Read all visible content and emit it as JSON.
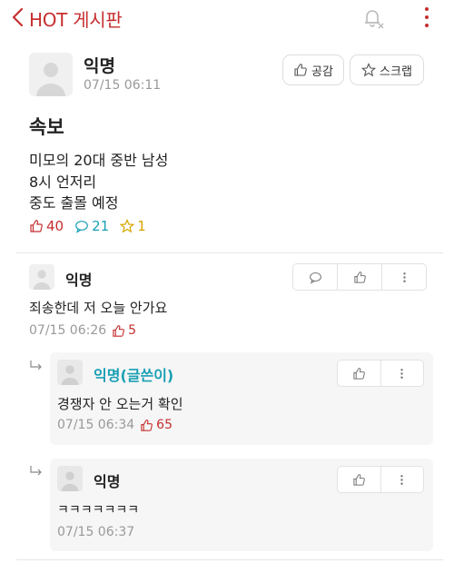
{
  "header": {
    "title": "HOT 게시판",
    "back_icon": "chevron-left-icon",
    "bell_icon": "bell-off-icon",
    "more_icon": "more-vertical-icon"
  },
  "post": {
    "author": "익명",
    "time": "07/15 06:11",
    "like_button": "공감",
    "scrap_button": "스크랩",
    "title": "속보",
    "body": [
      "미모의 20대 중반 남성",
      "8시 언저리",
      "중도 출몰 예정"
    ],
    "stats": {
      "likes": "40",
      "comments": "21",
      "scraps": "1"
    }
  },
  "comments": [
    {
      "author": "익명",
      "text": "죄송한데 저 오늘 안가요",
      "time": "07/15 06:26",
      "likes": "5"
    }
  ],
  "replies": [
    {
      "author": "익명(글쓴이)",
      "text": "경쟁자 안 오는거 확인",
      "time": "07/15 06:34",
      "likes": "65"
    },
    {
      "author": "익명",
      "text": "ㅋㅋㅋㅋㅋㅋㅋ",
      "time": "07/15 06:37"
    }
  ],
  "colors": {
    "accent": "#c62f2f",
    "comment": "#1b9fb5",
    "scrap": "#d6a500",
    "muted": "#999999"
  }
}
